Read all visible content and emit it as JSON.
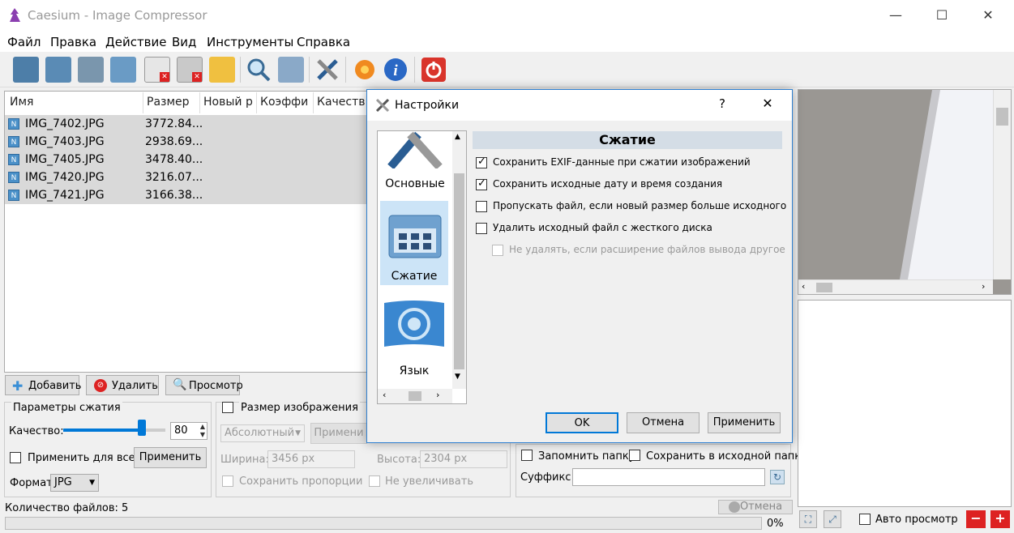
{
  "window": {
    "title": "Caesium - Image Compressor",
    "minimize": "—",
    "maximize": "☐",
    "close": "✕"
  },
  "menu": [
    "Файл",
    "Правка",
    "Действие",
    "Вид",
    "Инструменты",
    "Справка"
  ],
  "toolbar_icons": [
    "open-files-icon",
    "open-folder-icon",
    "save-icon",
    "load-list-icon",
    "remove-icon",
    "clear-list-icon",
    "clean-icon",
    "search-icon",
    "preview-settings-icon",
    "tools-icon",
    "compress-icon",
    "info-icon",
    "power-icon"
  ],
  "file_list": {
    "columns": [
      "Имя",
      "Размер",
      "Новый р",
      "Коэффи",
      "Качеств"
    ],
    "rows": [
      {
        "name": "IMG_7402.JPG",
        "size": "3772.84..."
      },
      {
        "name": "IMG_7403.JPG",
        "size": "2938.69..."
      },
      {
        "name": "IMG_7405.JPG",
        "size": "3478.40..."
      },
      {
        "name": "IMG_7420.JPG",
        "size": "3216.07..."
      },
      {
        "name": "IMG_7421.JPG",
        "size": "3166.38..."
      }
    ]
  },
  "list_buttons": {
    "add": "Добавить",
    "remove": "Удалить",
    "preview": "Просмотр"
  },
  "compression_params": {
    "title": "Параметры сжатия",
    "quality_label": "Качество:",
    "quality_value": "80",
    "apply_all_label": "Применить для всех",
    "apply_button": "Применить",
    "format_label": "Формат",
    "format_value": "JPG"
  },
  "resize": {
    "title": "Размер изображения",
    "mode": "Абсолютный",
    "apply_button": "Примени",
    "width_label": "Ширина:",
    "width_value": "3456 px",
    "height_label": "Высота:",
    "height_value": "2304 px",
    "keep_ratio": "Сохранить пропорции",
    "no_enlarge": "Не увеличивать"
  },
  "output": {
    "remember_folder": "Запомнить папку",
    "save_in_source": "Сохранить в исходной папке",
    "suffix_label": "Суффикс:",
    "suffix_value": ""
  },
  "status": {
    "file_count": "Количество файлов: 5",
    "cancel": "Отмена",
    "progress": "0%"
  },
  "preview_controls": {
    "auto_preview": "Авто просмотр"
  },
  "dialog": {
    "title": "Настройки",
    "help": "?",
    "close": "✕",
    "nav": [
      {
        "label": "Основные",
        "icon": "general-settings-icon"
      },
      {
        "label": "Сжатие",
        "icon": "compression-icon"
      },
      {
        "label": "Язык",
        "icon": "language-icon"
      }
    ],
    "section_title": "Сжатие",
    "options": [
      {
        "label": "Сохранить EXIF-данные при сжатии изображений",
        "checked": true,
        "enabled": true
      },
      {
        "label": "Сохранить исходные дату и время создания",
        "checked": true,
        "enabled": true
      },
      {
        "label": "Пропускать файл, если новый размер больше исходного",
        "checked": false,
        "enabled": true
      },
      {
        "label": "Удалить исходный файл с жесткого диска",
        "checked": false,
        "enabled": true
      },
      {
        "label": "Не удалять, если расширение файлов вывода другое",
        "checked": false,
        "enabled": false
      }
    ],
    "ok": "OK",
    "cancel": "Отмена",
    "apply": "Применить"
  },
  "colors": {
    "accent": "#0078d7",
    "dialog_border": "#2f80d0",
    "section_bg": "#d4dde6"
  }
}
